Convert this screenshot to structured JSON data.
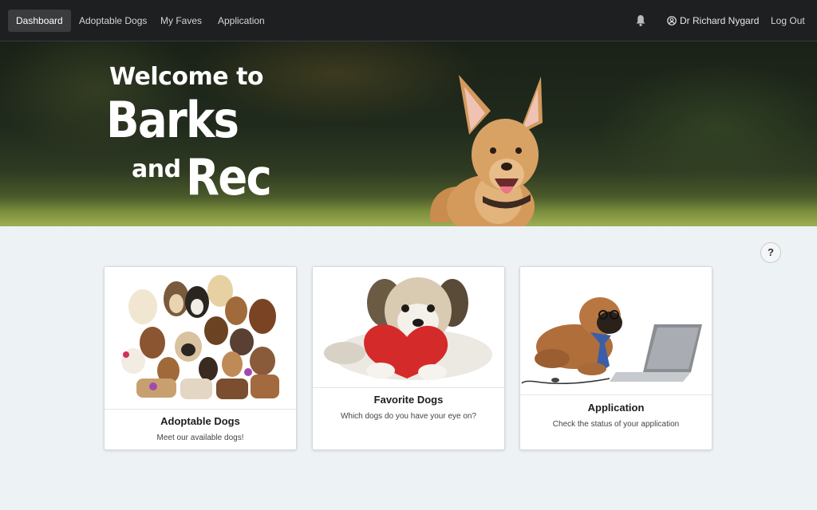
{
  "nav": {
    "links": [
      {
        "label": "Dashboard",
        "active": true
      },
      {
        "label": "Adoptable Dogs",
        "active": false
      },
      {
        "label": "My Faves",
        "active": false
      },
      {
        "label": "Application",
        "active": false
      }
    ],
    "notifications_icon": "bell-icon",
    "user_icon": "user-circle-icon",
    "user_name": "Dr Richard Nygard",
    "logout_label": "Log Out"
  },
  "hero": {
    "line1": "Welcome to",
    "line2": "Barks",
    "line3": "and",
    "line4": "Rec"
  },
  "help": {
    "label": "?"
  },
  "cards": [
    {
      "title": "Adoptable Dogs",
      "description": "Meet our available dogs!",
      "image": "group-of-dogs-image"
    },
    {
      "title": "Favorite Dogs",
      "description": "Which dogs do you have your eye on?",
      "image": "puppy-with-heart-image"
    },
    {
      "title": "Application",
      "description": "Check the status of your application",
      "image": "dog-with-laptop-image"
    }
  ],
  "colors": {
    "navbar": "#1e1f20",
    "nav_active": "#3b3c3e",
    "page_background": "#edf2f5",
    "card_background": "#ffffff"
  }
}
